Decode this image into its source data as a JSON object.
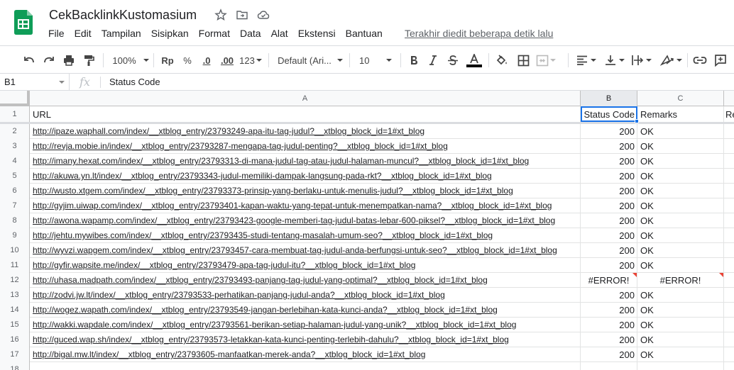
{
  "title": "CekBacklinkKustomasium",
  "menu": [
    "File",
    "Edit",
    "Tampilan",
    "Sisipkan",
    "Format",
    "Data",
    "Alat",
    "Ekstensi",
    "Bantuan"
  ],
  "last_edit": "Terakhir diedit beberapa detik lalu",
  "toolbar": {
    "zoom": "100%",
    "currency": "Rp",
    "percent": "%",
    "decrease_decimal": ".0",
    "increase_decimal": ".00",
    "number_format": "123",
    "font": "Default (Ari...",
    "font_size": "10"
  },
  "formula_bar": {
    "cell_ref": "B1",
    "fx": "fx",
    "content": "Status Code"
  },
  "columns": [
    "A",
    "B",
    "C"
  ],
  "header_row": {
    "num": "1",
    "a": "URL",
    "b": "Status Code",
    "c": "Remarks",
    "d": "Re"
  },
  "rows": [
    {
      "num": "2",
      "url": "http://ipaze.waphall.com/index/__xtblog_entry/23793249-apa-itu-tag-judul?__xtblog_block_id=1#xt_blog",
      "status": "200",
      "remark": "OK"
    },
    {
      "num": "3",
      "url": "http://revja.mobie.in/index/__xtblog_entry/23793287-mengapa-tag-judul-penting?__xtblog_block_id=1#xt_blog",
      "status": "200",
      "remark": "OK"
    },
    {
      "num": "4",
      "url": "http://imany.hexat.com/index/__xtblog_entry/23793313-di-mana-judul-tag-atau-judul-halaman-muncul?__xtblog_block_id=1#xt_blog",
      "status": "200",
      "remark": "OK"
    },
    {
      "num": "5",
      "url": "http://akuwa.yn.lt/index/__xtblog_entry/23793343-judul-memiliki-dampak-langsung-pada-rkt?__xtblog_block_id=1#xt_blog",
      "status": "200",
      "remark": "OK"
    },
    {
      "num": "6",
      "url": "http://wusto.xtgem.com/index/__xtblog_entry/23793373-prinsip-yang-berlaku-untuk-menulis-judul?__xtblog_block_id=1#xt_blog",
      "status": "200",
      "remark": "OK"
    },
    {
      "num": "7",
      "url": "http://gyjim.uiwap.com/index/__xtblog_entry/23793401-kapan-waktu-yang-tepat-untuk-menempatkan-nama?__xtblog_block_id=1#xt_blog",
      "status": "200",
      "remark": "OK"
    },
    {
      "num": "8",
      "url": "http://awona.wapamp.com/index/__xtblog_entry/23793423-google-memberi-tag-judul-batas-lebar-600-piksel?__xtblog_block_id=1#xt_blog",
      "status": "200",
      "remark": "OK"
    },
    {
      "num": "9",
      "url": "http://jehtu.mywibes.com/index/__xtblog_entry/23793435-studi-tentang-masalah-umum-seo?__xtblog_block_id=1#xt_blog",
      "status": "200",
      "remark": "OK"
    },
    {
      "num": "10",
      "url": "http://wyvzi.wapgem.com/index/__xtblog_entry/23793457-cara-membuat-tag-judul-anda-berfungsi-untuk-seo?__xtblog_block_id=1#xt_blog",
      "status": "200",
      "remark": "OK"
    },
    {
      "num": "11",
      "url": "http://gyfir.wapsite.me/index/__xtblog_entry/23793479-apa-tag-judul-itu?__xtblog_block_id=1#xt_blog",
      "status": "200",
      "remark": "OK"
    },
    {
      "num": "12",
      "url": "http://uhasa.madpath.com/index/__xtblog_entry/23793493-panjang-tag-judul-yang-optimal?__xtblog_block_id=1#xt_blog",
      "status": "#ERROR!",
      "remark": "#ERROR!",
      "error": true
    },
    {
      "num": "13",
      "url": "http://zodvi.jw.lt/index/__xtblog_entry/23793533-perhatikan-panjang-judul-anda?__xtblog_block_id=1#xt_blog",
      "status": "200",
      "remark": "OK"
    },
    {
      "num": "14",
      "url": "http://wogez.wapath.com/index/__xtblog_entry/23793549-jangan-berlebihan-kata-kunci-anda?__xtblog_block_id=1#xt_blog",
      "status": "200",
      "remark": "OK"
    },
    {
      "num": "15",
      "url": "http://wakki.wapdale.com/index/__xtblog_entry/23793561-berikan-setiap-halaman-judul-yang-unik?__xtblog_block_id=1#xt_blog",
      "status": "200",
      "remark": "OK"
    },
    {
      "num": "16",
      "url": "http://guced.wap.sh/index/__xtblog_entry/23793573-letakkan-kata-kunci-penting-terlebih-dahulu?__xtblog_block_id=1#xt_blog",
      "status": "200",
      "remark": "OK"
    },
    {
      "num": "17",
      "url": "http://bigal.mw.lt/index/__xtblog_entry/23793605-manfaatkan-merek-anda?__xtblog_block_id=1#xt_blog",
      "status": "200",
      "remark": "OK"
    },
    {
      "num": "18",
      "url": "",
      "status": "",
      "remark": ""
    }
  ],
  "colors": {
    "sheets_green": "#0f9d58",
    "selection_blue": "#1a73e8",
    "error_red": "#ea4335"
  }
}
